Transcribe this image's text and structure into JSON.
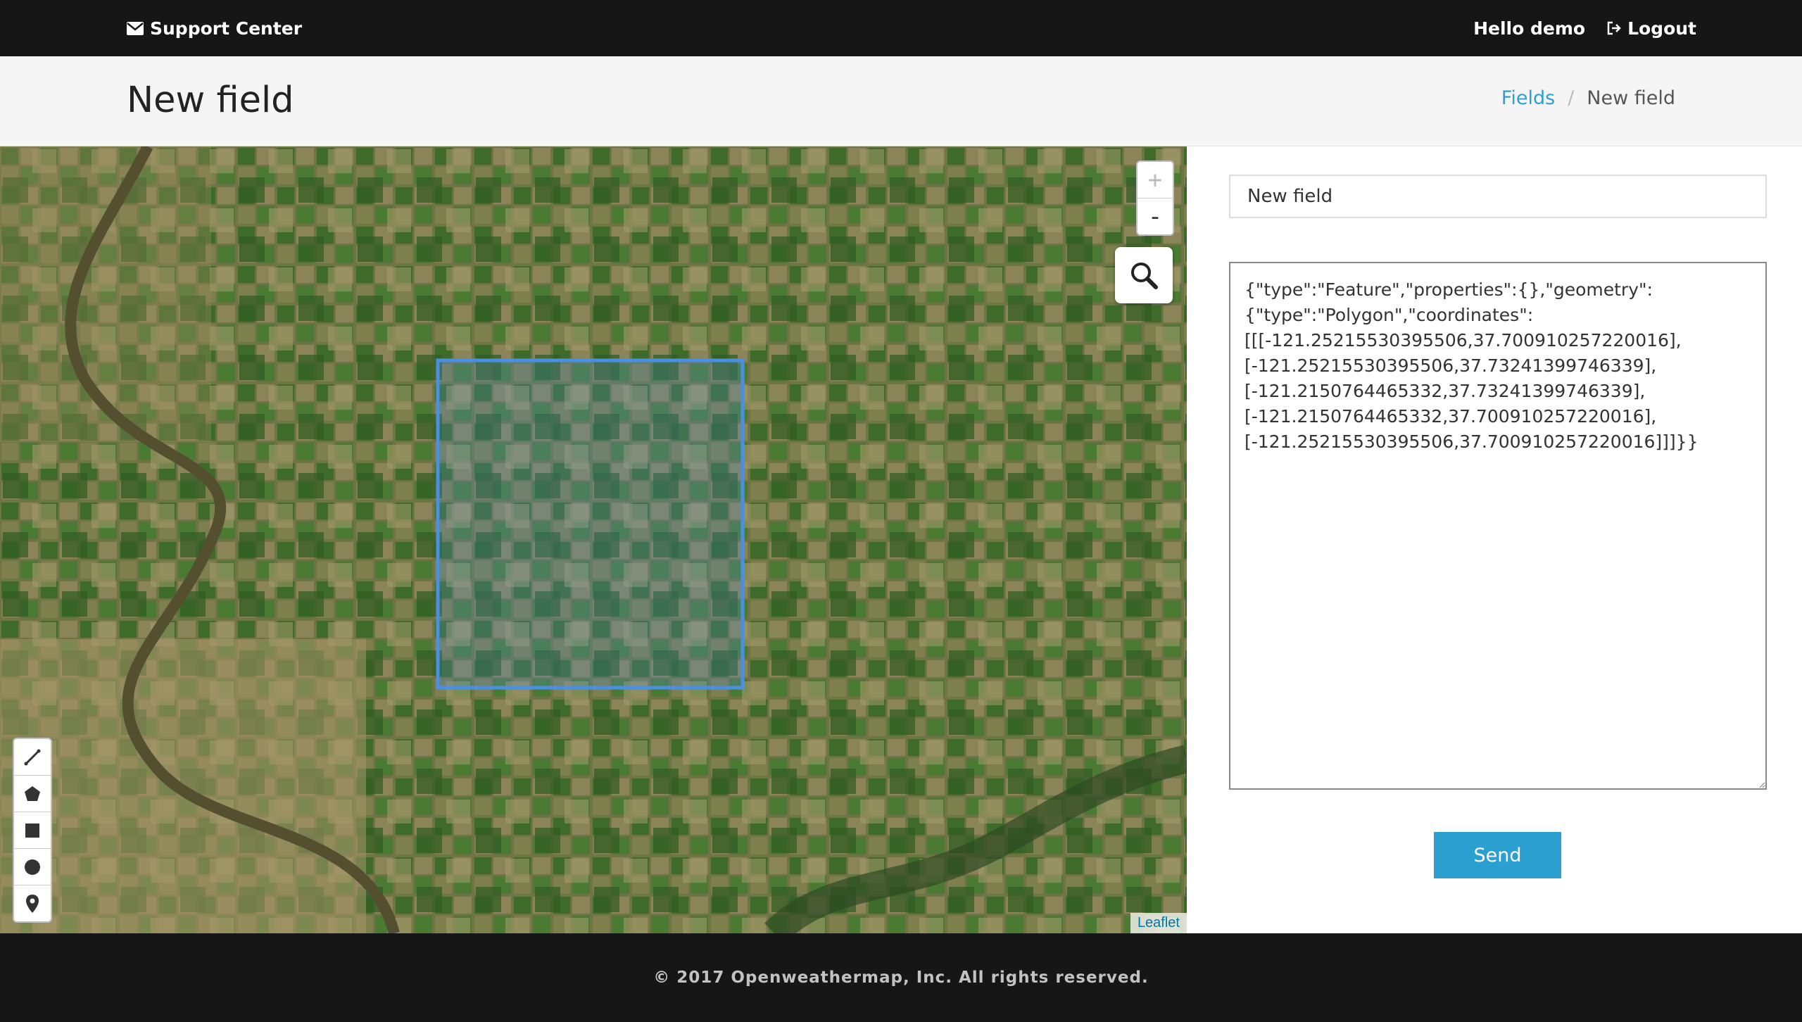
{
  "nav": {
    "brand": "Support Center",
    "greeting": "Hello demo",
    "logout": "Logout"
  },
  "header": {
    "title": "New field",
    "breadcrumb": [
      {
        "label": "Fields"
      },
      {
        "label": "New field"
      }
    ]
  },
  "map": {
    "zoom_in": "+",
    "zoom_out": "-",
    "attribution": "Leaflet",
    "highlight_color": "#4a90e2",
    "draw_tools": [
      "polyline-icon",
      "polygon-icon",
      "rectangle-icon",
      "circle-icon",
      "marker-icon"
    ]
  },
  "form": {
    "name_value": "New field",
    "geojson_value": "{\"type\":\"Feature\",\"properties\":{},\"geometry\":\n{\"type\":\"Polygon\",\"coordinates\":\n[[[-121.25215530395506,37.700910257220016],\n[-121.25215530395506,37.73241399746339],\n[-121.2150764465332,37.73241399746339],\n[-121.2150764465332,37.700910257220016],\n[-121.25215530395506,37.700910257220016]]]}}",
    "send_label": "Send",
    "send_color": "#2a9fd0"
  },
  "footer": {
    "text": "© 2017 Openweathermap, Inc. All rights reserved."
  }
}
